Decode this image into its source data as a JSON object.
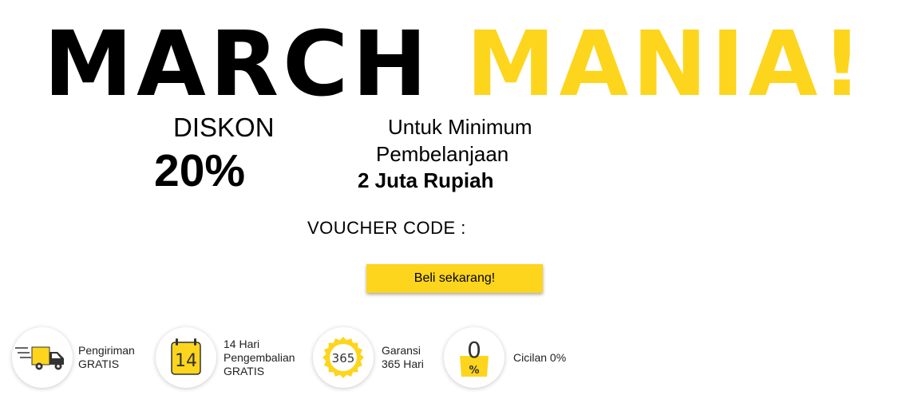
{
  "promo": {
    "title_word1": "MARCH",
    "title_word2": "MANIA!",
    "discount_label": "DISKON",
    "discount_value": "20%",
    "min_line1": "Untuk Minimum",
    "min_line2": "Pembelanjaan",
    "min_amount": "2 Juta Rupiah",
    "voucher_label": "VOUCHER CODE :",
    "cta_label": "Beli sekarang!"
  },
  "features": [
    {
      "icon": "delivery-truck-icon",
      "lines": [
        "Pengiriman",
        "GRATIS"
      ]
    },
    {
      "icon": "calendar-14-icon",
      "badge": "14",
      "lines": [
        "14 Hari",
        "Pengembalian",
        "GRATIS"
      ]
    },
    {
      "icon": "warranty-badge-icon",
      "badge": "365",
      "lines": [
        "Garansi",
        "365 Hari"
      ]
    },
    {
      "icon": "installment-bag-icon",
      "badge_top": "0",
      "badge_bottom": "%",
      "lines": [
        "Cicilan 0%"
      ]
    }
  ],
  "colors": {
    "accent": "#FDD51D",
    "text": "#000000",
    "icon_dark": "#333333"
  }
}
